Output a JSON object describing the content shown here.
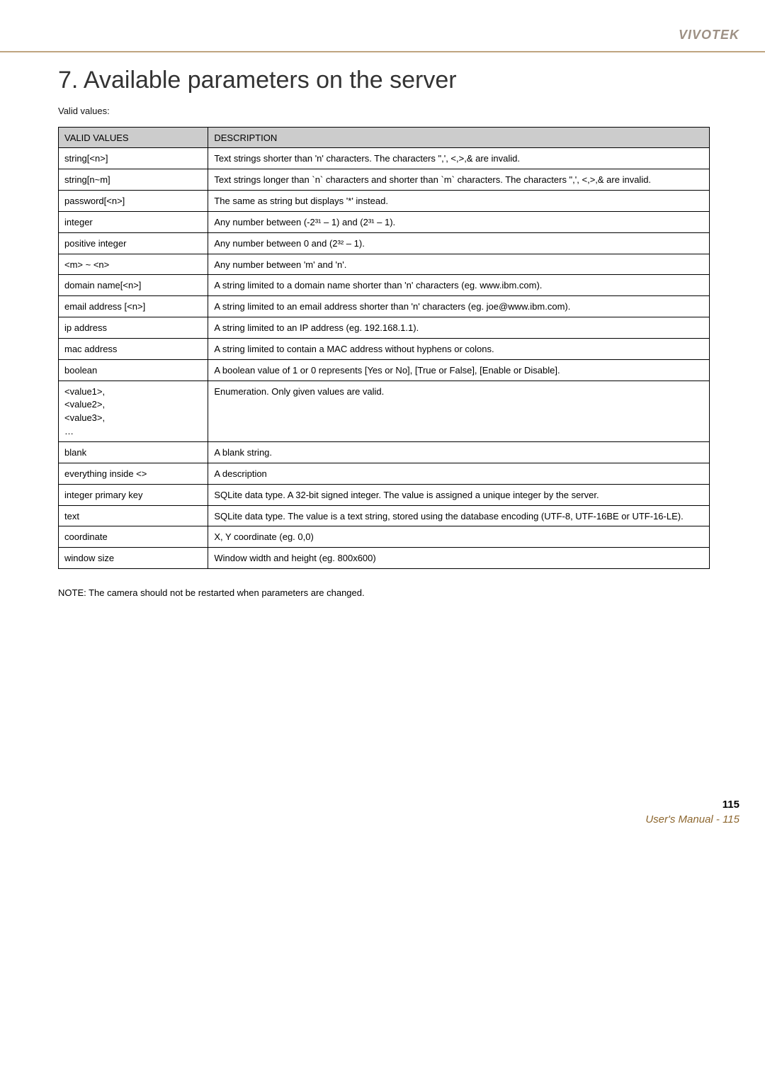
{
  "brand": "VIVOTEK",
  "section_number_title": "7. Available parameters on the server",
  "intro": [
    "Valid values:"
  ],
  "table": {
    "headers": [
      "VALID VALUES",
      "DESCRIPTION"
    ],
    "rows": [
      {
        "name": "string[<n>]",
        "desc": "Text strings shorter than 'n' characters. The characters \",', <,>,& are invalid."
      },
      {
        "name": "string[n~m]",
        "desc": "Text strings longer than `n` characters and shorter than `m` characters. The characters \",', <,>,& are invalid."
      },
      {
        "name": "password[<n>]",
        "desc": "The same as string but displays '*' instead."
      },
      {
        "name": "integer",
        "desc": "Any number between (-2³¹ – 1) and (2³¹ – 1)."
      },
      {
        "name": "positive integer",
        "desc": "Any number between 0 and (2³² – 1)."
      },
      {
        "name": "<m> ~ <n>",
        "desc": "Any number between 'm' and 'n'."
      },
      {
        "name": "domain name[<n>]",
        "desc": "A string limited to a domain name shorter than 'n' characters (eg. www.ibm.com)."
      },
      {
        "name": "email address [<n>]",
        "desc": "A string limited to an email address shorter than 'n' characters (eg. joe@www.ibm.com)."
      },
      {
        "name": "ip address",
        "desc": "A string limited to an IP address (eg. 192.168.1.1)."
      },
      {
        "name": "mac address",
        "desc": "A string limited to contain a MAC address without hyphens or colons."
      },
      {
        "name": "boolean",
        "desc": "A boolean value of 1 or 0 represents [Yes or No], [True or False], [Enable or Disable]."
      },
      {
        "name": "<value1>,\n<value2>,\n<value3>,\n…",
        "desc": "Enumeration. Only given values are valid."
      },
      {
        "name": "blank",
        "desc": "A blank string."
      },
      {
        "name": "everything inside <>",
        "desc": "A description"
      },
      {
        "name": "integer primary key",
        "desc": "SQLite data type. A 32-bit signed integer. The value is assigned a unique integer by the server."
      },
      {
        "name": "text",
        "desc": "SQLite data type. The value is a text string, stored using the database encoding (UTF-8, UTF-16BE or UTF-16-LE)."
      },
      {
        "name": "coordinate",
        "desc": "X, Y coordinate (eg. 0,0)"
      },
      {
        "name": "window size",
        "desc": "Window width and height (eg. 800x600)"
      }
    ]
  },
  "notes": "NOTE: The camera should not be restarted when parameters are changed.",
  "page_number": "115",
  "footer": "User's Manual - 115"
}
